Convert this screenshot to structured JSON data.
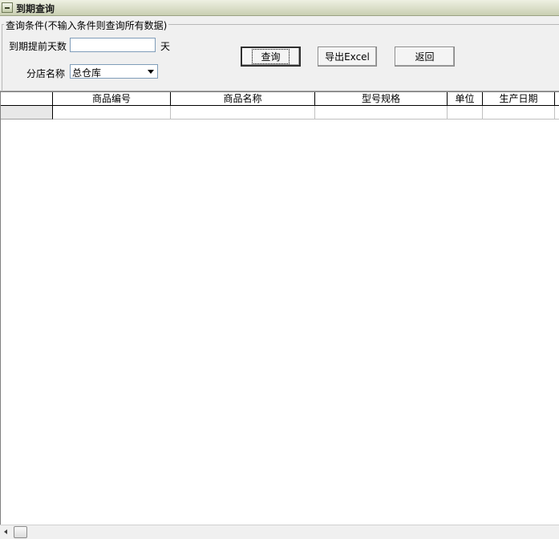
{
  "window": {
    "title": "到期查询"
  },
  "query": {
    "legend": "查询条件(不输入条件则查询所有数据)",
    "days_label": "到期提前天数",
    "days_value": "",
    "days_unit": "天",
    "store_label": "分店名称",
    "store_value": "总仓库"
  },
  "buttons": {
    "query": "查询",
    "export": "导出Excel",
    "back": "返回"
  },
  "grid": {
    "columns": [
      "商品编号",
      "商品名称",
      "型号规格",
      "单位",
      "生产日期"
    ]
  }
}
